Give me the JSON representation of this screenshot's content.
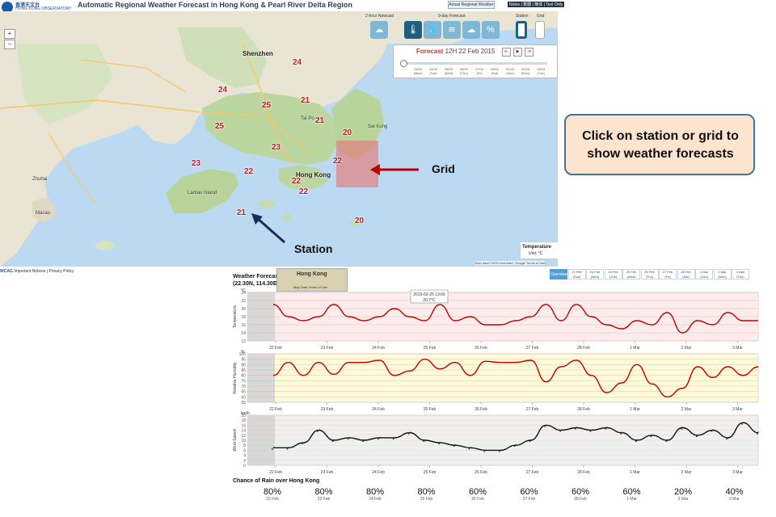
{
  "header": {
    "logo_cn": "香港天文台",
    "logo_en": "HONG KONG OBSERVATORY",
    "title": "Automatic Regional Weather Forecast in Hong Kong & Pearl River Delta Region",
    "actual_button": "Actual Regional Weather",
    "top_links": "Notes | 繁體 | 簡体 | Text Only"
  },
  "map": {
    "zoom_in": "+",
    "zoom_out": "−",
    "places": [
      "Shenzhen",
      "Hong Kong",
      "Macau",
      "Zhuhai",
      "Tai Po",
      "Sai Kung",
      "Lantau Island"
    ],
    "temperatures": [
      "24",
      "24",
      "25",
      "25",
      "21",
      "21",
      "20",
      "23",
      "23",
      "22",
      "22",
      "22",
      "22",
      "21",
      "20"
    ],
    "legend_title": "Temperature",
    "legend_unit": "Unit: °C",
    "credit": "Map data ©2015 AutoNavi, Google   Terms of Use"
  },
  "controls": {
    "label_2hr": "2-hour Nowcast",
    "label_9day": "9-day Forecast",
    "label_station": "Station",
    "label_grid": "Grid",
    "icons": [
      "rain-cloud-icon",
      "thermometer-icon",
      "humidity-drop-icon",
      "wind-icon",
      "cloud-icon",
      "rain-chance-icon"
    ],
    "forecast_label": "Forecast",
    "forecast_time": "12H 22 Feb 2015",
    "nav_first": "⇤",
    "nav_play": "▶",
    "nav_last": "⇥",
    "slider_dates": [
      {
        "d": "23/02",
        "w": "(Mon)"
      },
      {
        "d": "24/02",
        "w": "(Tue)"
      },
      {
        "d": "25/02",
        "w": "(Wed)"
      },
      {
        "d": "26/02",
        "w": "(Thu)"
      },
      {
        "d": "27/02",
        "w": "(Fri)"
      },
      {
        "d": "28/02",
        "w": "(Sat)"
      },
      {
        "d": "01/03",
        "w": "(Sun)"
      },
      {
        "d": "02/03",
        "w": "(Mon)"
      },
      {
        "d": "03/03",
        "w": "(Tue)"
      }
    ],
    "slider_position": 0.0
  },
  "annotations": {
    "callout": "Click on station or grid to show weather forecasts",
    "grid": "Grid",
    "station": "Station"
  },
  "footer": {
    "links": "Important Notices | Privacy Policy"
  },
  "forecast": {
    "title_line1": "Weather Forecast",
    "title_line2": "(22.30N, 114.30E)",
    "mini_map_label": "Hong Kong",
    "mini_map_credit": "Map Data   Terms of Use",
    "tabs": [
      {
        "top": "Overview",
        "bottom": ""
      },
      {
        "top": "22 Feb",
        "bottom": "(Sun)"
      },
      {
        "top": "23 Feb",
        "bottom": "(Mon)"
      },
      {
        "top": "24 Feb",
        "bottom": "(Tue)"
      },
      {
        "top": "25 Feb",
        "bottom": "(Wed)"
      },
      {
        "top": "26 Feb",
        "bottom": "(Thu)"
      },
      {
        "top": "27 Feb",
        "bottom": "(Fri)"
      },
      {
        "top": "28 Feb",
        "bottom": "(Sat)"
      },
      {
        "top": "1 Mar",
        "bottom": "(Sun)"
      },
      {
        "top": "2 Mar",
        "bottom": "(Mon)"
      },
      {
        "top": "3 Mar",
        "bottom": "(Tue)"
      }
    ],
    "tooltip_time": "2015-02-25 13:00",
    "tooltip_value": "20.7°C",
    "x_labels": [
      "22 Feb",
      "23 Feb",
      "24 Feb",
      "25 Feb",
      "26 Feb",
      "27 Feb",
      "28 Feb",
      "1 Mar",
      "2 Mar",
      "3 Mar"
    ],
    "rain_title": "Chance of Rain over Hong Kong",
    "rain": [
      {
        "pct": "80%",
        "date": "22 Feb"
      },
      {
        "pct": "80%",
        "date": "23 Feb"
      },
      {
        "pct": "80%",
        "date": "24 Feb"
      },
      {
        "pct": "80%",
        "date": "25 Feb"
      },
      {
        "pct": "60%",
        "date": "26 Feb"
      },
      {
        "pct": "60%",
        "date": "27 Feb"
      },
      {
        "pct": "60%",
        "date": "28 Feb"
      },
      {
        "pct": "60%",
        "date": "1 Mar"
      },
      {
        "pct": "20%",
        "date": "2 Mar"
      },
      {
        "pct": "40%",
        "date": "3 Mar"
      }
    ]
  },
  "chart_data": [
    {
      "type": "line",
      "ylabel": "Temperature",
      "unit": "°C",
      "ylim": [
        12,
        24
      ],
      "yticks": [
        12,
        14,
        16,
        18,
        20,
        22,
        24
      ],
      "x": [
        "22 Feb",
        "23 Feb",
        "24 Feb",
        "25 Feb",
        "26 Feb",
        "27 Feb",
        "28 Feb",
        "1 Mar",
        "2 Mar",
        "3 Mar"
      ],
      "series": [
        {
          "color": "#c00000",
          "values": [
            21,
            18,
            17,
            18,
            21,
            18,
            17,
            18,
            20,
            18,
            17,
            21,
            17,
            18,
            16,
            16,
            17,
            18,
            21,
            17,
            21,
            18,
            16,
            15,
            17,
            16,
            19,
            14,
            17,
            16,
            19,
            17,
            17
          ]
        }
      ],
      "background": "#fdecec",
      "grid": true
    },
    {
      "type": "line",
      "ylabel": "Relative Humidity",
      "unit": "%",
      "ylim": [
        55,
        100
      ],
      "yticks": [
        55,
        60,
        65,
        70,
        75,
        80,
        85,
        90,
        95,
        100
      ],
      "x": [
        "22 Feb",
        "23 Feb",
        "24 Feb",
        "25 Feb",
        "26 Feb",
        "27 Feb",
        "28 Feb",
        "1 Mar",
        "2 Mar",
        "3 Mar"
      ],
      "series": [
        {
          "color": "#c00000",
          "values": [
            80,
            92,
            80,
            92,
            81,
            92,
            92,
            94,
            80,
            84,
            95,
            86,
            92,
            80,
            93,
            92,
            92,
            94,
            74,
            88,
            94,
            80,
            64,
            73,
            90,
            72,
            60,
            68,
            88,
            78,
            88,
            80,
            88
          ]
        }
      ],
      "background": "#fdfbd8",
      "grid": true
    },
    {
      "type": "line",
      "ylabel": "Wind Speed",
      "unit": "km/h",
      "ylim": [
        0,
        20
      ],
      "yticks": [
        0,
        2,
        4,
        6,
        8,
        10,
        12,
        14,
        16,
        18,
        20
      ],
      "x": [
        "22 Feb",
        "23 Feb",
        "24 Feb",
        "25 Feb",
        "26 Feb",
        "27 Feb",
        "28 Feb",
        "1 Mar",
        "2 Mar",
        "3 Mar"
      ],
      "series": [
        {
          "color": "#111111",
          "values": [
            7,
            7,
            9,
            14,
            10,
            11,
            10,
            11,
            11,
            13,
            10,
            9,
            8,
            7,
            6,
            6,
            8,
            10,
            16,
            14,
            15,
            14,
            15,
            13,
            10,
            12,
            10,
            15,
            12,
            14,
            11,
            17,
            13
          ]
        }
      ],
      "background": "#f0f0f0",
      "grid": true
    }
  ]
}
